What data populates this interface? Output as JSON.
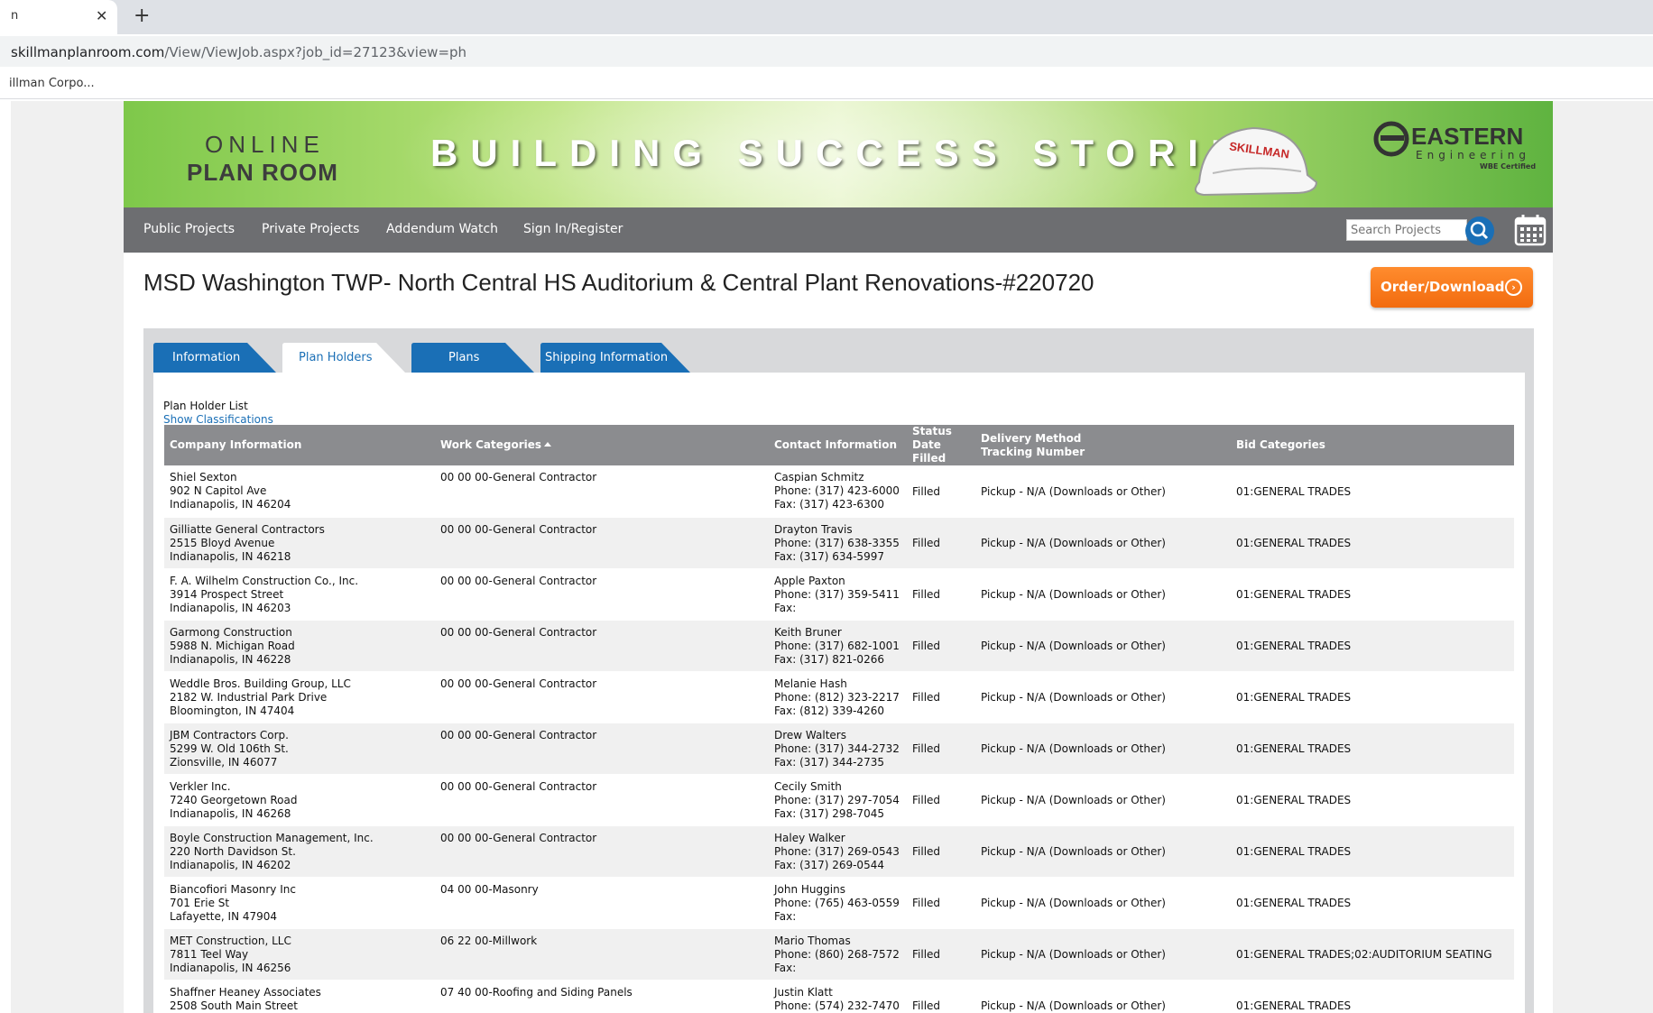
{
  "browser": {
    "tab_title": "n",
    "tab_close": "✕",
    "new_tab": "+",
    "url_host": "skillmanplanroom.com",
    "url_path": "/View/ViewJob.aspx?job_id=27123&view=ph",
    "bookmark": "illman Corpo..."
  },
  "banner": {
    "online": "ONLINE",
    "plan_room": "PLAN ROOM",
    "tagline": "BUILDING SUCCESS STORIES",
    "hardhat_text": "SKILLMAN",
    "eastern": "EASTERN",
    "engineering": "Engineering",
    "wbe": "WBE Certified"
  },
  "nav": {
    "items": [
      "Public Projects",
      "Private Projects",
      "Addendum Watch",
      "Sign In/Register"
    ],
    "search_placeholder": "Search Projects"
  },
  "project": {
    "title": "MSD Washington TWP- North Central HS Auditorium & Central Plant Renovations-#220720",
    "order_button": "Order/Download"
  },
  "tabs": [
    "Information",
    "Plan Holders",
    "Plans",
    "Shipping Information"
  ],
  "active_tab": "Plan Holders",
  "list": {
    "label": "Plan Holder List",
    "show_classifications": "Show Classifications",
    "headers": {
      "company": "Company Information",
      "work": "Work Categories",
      "contact": "Contact Information",
      "status1": "Status",
      "status2": "Date Filled",
      "delivery1": "Delivery Method",
      "delivery2": "Tracking Number",
      "bid": "Bid Categories"
    },
    "rows": [
      {
        "company": [
          "Shiel Sexton",
          "902 N Capitol Ave",
          "Indianapolis, IN 46204"
        ],
        "work": "00 00 00-General Contractor",
        "contact": [
          "Caspian Schmitz",
          "Phone: (317) 423-6000",
          "Fax: (317) 423-6300"
        ],
        "status": "Filled",
        "delivery": "Pickup - N/A (Downloads or Other)",
        "bid": "01:GENERAL TRADES"
      },
      {
        "company": [
          "Gilliatte General Contractors",
          "2515 Bloyd Avenue",
          "Indianapolis, IN 46218"
        ],
        "work": "00 00 00-General Contractor",
        "contact": [
          "Drayton Travis",
          "Phone: (317) 638-3355",
          "Fax: (317) 634-5997"
        ],
        "status": "Filled",
        "delivery": "Pickup - N/A (Downloads or Other)",
        "bid": "01:GENERAL TRADES"
      },
      {
        "company": [
          "F. A. Wilhelm Construction Co., Inc.",
          "3914 Prospect Street",
          "Indianapolis, IN 46203"
        ],
        "work": "00 00 00-General Contractor",
        "contact": [
          "Apple Paxton",
          "Phone: (317) 359-5411",
          "Fax:"
        ],
        "status": "Filled",
        "delivery": "Pickup - N/A (Downloads or Other)",
        "bid": "01:GENERAL TRADES"
      },
      {
        "company": [
          "Garmong Construction",
          "5988 N. Michigan Road",
          "Indianapolis, IN 46228"
        ],
        "work": "00 00 00-General Contractor",
        "contact": [
          "Keith Bruner",
          "Phone: (317) 682-1001",
          "Fax: (317) 821-0266"
        ],
        "status": "Filled",
        "delivery": "Pickup - N/A (Downloads or Other)",
        "bid": "01:GENERAL TRADES"
      },
      {
        "company": [
          "Weddle Bros. Building Group, LLC",
          "2182 W. Industrial Park Drive",
          "Bloomington, IN 47404"
        ],
        "work": "00 00 00-General Contractor",
        "contact": [
          "Melanie Hash",
          "Phone: (812) 323-2217",
          "Fax: (812) 339-4260"
        ],
        "status": "Filled",
        "delivery": "Pickup - N/A (Downloads or Other)",
        "bid": "01:GENERAL TRADES"
      },
      {
        "company": [
          "JBM Contractors Corp.",
          "5299 W. Old 106th St.",
          "Zionsville, IN 46077"
        ],
        "work": "00 00 00-General Contractor",
        "contact": [
          "Drew Walters",
          "Phone: (317) 344-2732",
          "Fax: (317) 344-2735"
        ],
        "status": "Filled",
        "delivery": "Pickup - N/A (Downloads or Other)",
        "bid": "01:GENERAL TRADES"
      },
      {
        "company": [
          "Verkler Inc.",
          "7240 Georgetown Road",
          "Indianapolis, IN 46268"
        ],
        "work": "00 00 00-General Contractor",
        "contact": [
          "Cecily Smith",
          "Phone: (317) 297-7054",
          "Fax: (317) 298-7045"
        ],
        "status": "Filled",
        "delivery": "Pickup - N/A (Downloads or Other)",
        "bid": "01:GENERAL TRADES"
      },
      {
        "company": [
          "Boyle Construction Management, Inc.",
          "220 North Davidson St.",
          "Indianapolis, IN 46202"
        ],
        "work": "00 00 00-General Contractor",
        "contact": [
          "Haley Walker",
          "Phone: (317) 269-0543",
          "Fax: (317) 269-0544"
        ],
        "status": "Filled",
        "delivery": "Pickup - N/A (Downloads or Other)",
        "bid": "01:GENERAL TRADES"
      },
      {
        "company": [
          "Biancofiori Masonry Inc",
          "701 Erie St",
          "Lafayette, IN 47904"
        ],
        "work": "04 00 00-Masonry",
        "contact": [
          "John Huggins",
          "Phone: (765) 463-0559",
          "Fax:"
        ],
        "status": "Filled",
        "delivery": "Pickup - N/A (Downloads or Other)",
        "bid": "01:GENERAL TRADES"
      },
      {
        "company": [
          "MET Construction, LLC",
          "7811 Teel Way",
          "Indianapolis, IN 46256"
        ],
        "work": "06 22 00-Millwork",
        "contact": [
          "Mario Thomas",
          "Phone: (860) 268-7572",
          "Fax:"
        ],
        "status": "Filled",
        "delivery": "Pickup - N/A (Downloads or Other)",
        "bid": "01:GENERAL TRADES;02:AUDITORIUM SEATING"
      },
      {
        "company": [
          "Shaffner Heaney Associates",
          "2508 South Main Street"
        ],
        "work": "07 40 00-Roofing and Siding Panels",
        "contact": [
          "Justin Klatt",
          "Phone: (574) 232-7470"
        ],
        "status": "Filled",
        "delivery": "Pickup - N/A (Downloads or Other)",
        "bid": "01:GENERAL TRADES"
      }
    ]
  },
  "colors": {
    "nav_bg": "#6d6e71",
    "tab_blue": "#1a6fb6",
    "order_orange": "#f26b0f",
    "table_header": "#8b8c8f"
  },
  "icons": [
    "close-icon",
    "plus-icon",
    "search-icon",
    "calendar-icon",
    "chevron-right-icon",
    "sort-up-icon"
  ]
}
